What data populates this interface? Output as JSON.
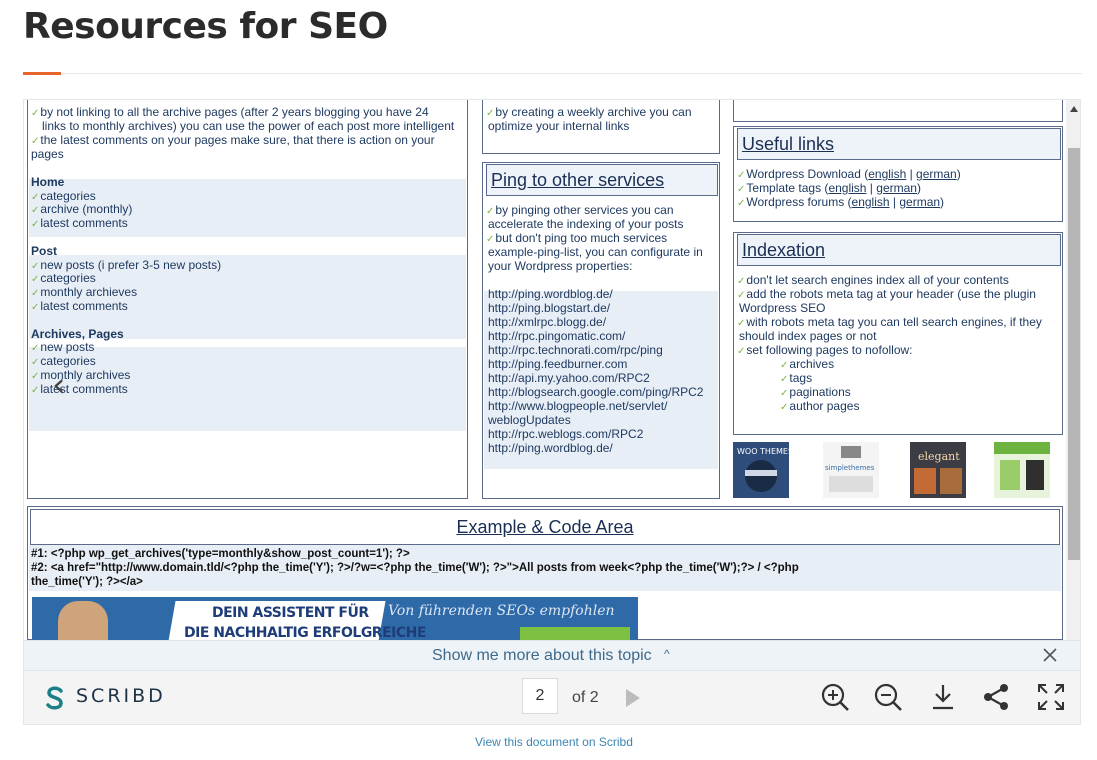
{
  "page": {
    "title": "Resources for SEO"
  },
  "document": {
    "left_column": {
      "intro": [
        "by not linking to all the archive pages (after 2 years blogging you have 24",
        "links to monthly archives) you can use the power of each post more intelligent",
        "the latest comments on your pages make sure, that there is  action on your",
        "pages"
      ],
      "sections": [
        {
          "heading": "Home",
          "items": [
            "categories",
            "archive (monthly)",
            "latest comments"
          ]
        },
        {
          "heading": "Post",
          "items": [
            "new posts (i prefer 3-5 new posts)",
            "categories",
            "monthly archieves",
            "latest comments"
          ]
        },
        {
          "heading": "Archives, Pages",
          "items": [
            "new posts",
            "categories",
            "monthly archives",
            "latest comments"
          ]
        }
      ]
    },
    "middle_top": [
      "by creating a weekly archive you can",
      "optimize your internal links"
    ],
    "ping": {
      "title": "Ping to other services",
      "text": [
        "by pinging other services you can",
        "accelerate the indexing of your posts",
        "but don't ping too much services",
        "example-ping-list, you can configurate in",
        "your Wordpress properties:"
      ],
      "urls": [
        "http://ping.wordblog.de/",
        "http://ping.blogstart.de/",
        "http://xmlrpc.blogg.de/",
        "http://rpc.pingomatic.com/",
        "http://rpc.technorati.com/rpc/ping",
        "http://ping.feedburner.com",
        "http://api.my.yahoo.com/RPC2",
        "http://blogsearch.google.com/ping/RPC2",
        "http://www.blogpeople.net/servlet/",
        "weblogUpdates",
        "http://rpc.weblogs.com/RPC2",
        "http://ping.wordblog.de/"
      ]
    },
    "useful_links": {
      "title": "Useful links",
      "items": [
        {
          "label": "Wordpress Download (",
          "a": "english",
          "sep": " | ",
          "b": "german",
          "end": ")"
        },
        {
          "label": "Template tags (",
          "a": "english",
          "sep": " | ",
          "b": "german",
          "end": ")"
        },
        {
          "label": "Wordpress forums (",
          "a": "english",
          "sep": " | ",
          "b": "german",
          "end": ")"
        }
      ]
    },
    "indexation": {
      "title": "Indexation",
      "items": [
        "don't let search engines index all of your contents",
        "add the robots meta tag at your header (use the plugin",
        "Wordpress SEO",
        "with robots meta tag you can tell  search engines, if they",
        "should index pages or not",
        "set following pages to nofollow:"
      ],
      "subitems": [
        "archives",
        "tags",
        "paginations",
        "author pages"
      ]
    },
    "thumbnails": [
      {
        "name": "woo-themes-thumb",
        "label": "WOO THEMES",
        "color": "#3a5a8a"
      },
      {
        "name": "simple-themes-thumb",
        "label": "simplethemes",
        "color": "#f2f2f2"
      },
      {
        "name": "elegant-themes-thumb",
        "label": "elegant",
        "color": "#b2552a"
      },
      {
        "name": "green-theme-thumb",
        "label": "",
        "color": "#6cb33f"
      }
    ],
    "example": {
      "title": "Example & Code Area",
      "code1": "#1:  <?php wp_get_archives('type=monthly&show_post_count=1'); ?>",
      "code2a": "#2:  <a href=\"http://www.domain.tld/<?php the_time('Y'); ?>/?w=<?php the_time('W'); ?>\">All posts from week<?php the_time('W');?> / <?php",
      "code2b": "the_time('Y'); ?></a>",
      "ad_line1": "DEIN ASSISTENT FÜR",
      "ad_line2": "DIE NACHHALTIG ERFOLGREICHE",
      "ad_script": "Von führenden SEOs empfohlen"
    }
  },
  "viewer": {
    "more_topic": "Show me more about this topic",
    "brand": "SCRIBD",
    "current_page": "2",
    "of_pages": "of 2",
    "view_link": "View this document on Scribd"
  },
  "colors": {
    "accent": "#e8652c",
    "check": "#7cb342",
    "link": "#3b86b3"
  }
}
